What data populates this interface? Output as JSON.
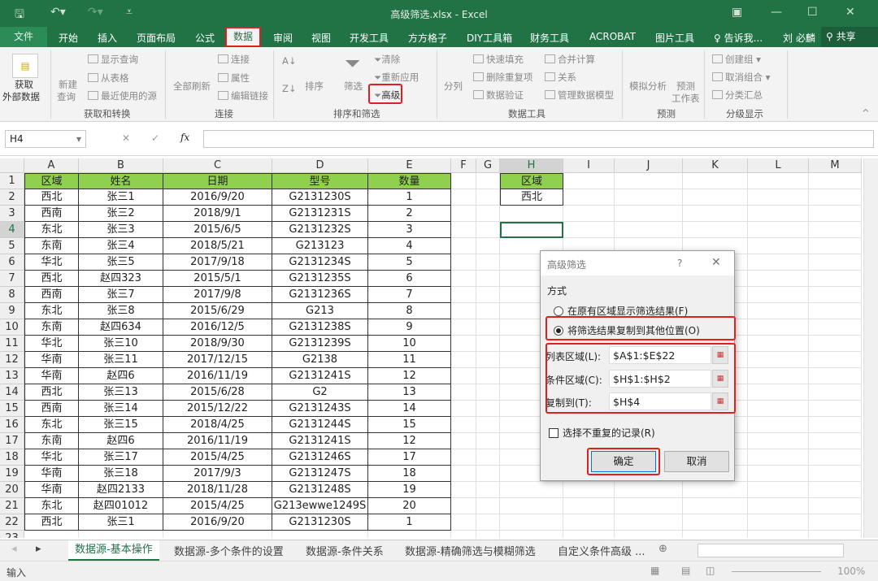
{
  "window": {
    "title": "高级筛选.xlsx - Excel",
    "user": "刘 必麟",
    "share": "共享",
    "tell_me": "告诉我..."
  },
  "tabs": [
    "文件",
    "开始",
    "插入",
    "页面布局",
    "公式",
    "数据",
    "审阅",
    "视图",
    "开发工具",
    "方方格子",
    "DIY工具箱",
    "财务工具",
    "ACROBAT",
    "图片工具"
  ],
  "active_tab": "数据",
  "ribbon": {
    "get_external": "获取\n外部数据",
    "get_external_1": "获取",
    "get_external_2": "外部数据",
    "new_query_1": "新建",
    "new_query_2": "查询",
    "show_queries": "显示查询",
    "from_table": "从表格",
    "recent_sources": "最近使用的源",
    "group_get": "获取和转换",
    "refresh_all": "全部刷新",
    "connections": "连接",
    "properties": "属性",
    "edit_links": "编辑链接",
    "group_conn": "连接",
    "sort": "排序",
    "filter": "筛选",
    "clear": "清除",
    "reapply": "重新应用",
    "advanced": "高级",
    "group_sort": "排序和筛选",
    "text_to_columns": "分列",
    "flash_fill": "快速填充",
    "remove_dup": "删除重复项",
    "data_validation": "数据验证",
    "consolidate": "合并计算",
    "relationships": "关系",
    "manage_model": "管理数据模型",
    "group_tools": "数据工具",
    "what_if": "模拟分析",
    "forecast_1": "预测",
    "forecast_2": "工作表",
    "group_forecast": "预测",
    "group_create": "创建组",
    "ungroup": "取消组合",
    "subtotal": "分类汇总",
    "group_outline": "分级显示"
  },
  "formula_bar": {
    "name_box": "H4",
    "fx": "fx",
    "value": ""
  },
  "columns": [
    "A",
    "B",
    "C",
    "D",
    "E",
    "F",
    "G",
    "H",
    "I",
    "J",
    "K",
    "L",
    "M"
  ],
  "table": {
    "headers": [
      "区域",
      "姓名",
      "日期",
      "型号",
      "数量"
    ],
    "rows": [
      [
        "西北",
        "张三1",
        "2016/9/20",
        "G2131230S",
        "1"
      ],
      [
        "西南",
        "张三2",
        "2018/9/1",
        "G2131231S",
        "2"
      ],
      [
        "东北",
        "张三3",
        "2015/6/5",
        "G2131232S",
        "3"
      ],
      [
        "东南",
        "张三4",
        "2018/5/21",
        "G213123",
        "4"
      ],
      [
        "华北",
        "张三5",
        "2017/9/18",
        "G2131234S",
        "5"
      ],
      [
        "西北",
        "赵四323",
        "2015/5/1",
        "G2131235S",
        "6"
      ],
      [
        "西南",
        "张三7",
        "2017/9/8",
        "G2131236S",
        "7"
      ],
      [
        "东北",
        "张三8",
        "2015/6/29",
        "G213",
        "8"
      ],
      [
        "东南",
        "赵四634",
        "2016/12/5",
        "G2131238S",
        "9"
      ],
      [
        "华北",
        "张三10",
        "2018/9/30",
        "G2131239S",
        "10"
      ],
      [
        "华南",
        "张三11",
        "2017/12/15",
        "G2138",
        "11"
      ],
      [
        "华南",
        "赵四6",
        "2016/11/19",
        "G2131241S",
        "12"
      ],
      [
        "西北",
        "张三13",
        "2015/6/28",
        "G2",
        "13"
      ],
      [
        "西南",
        "张三14",
        "2015/12/22",
        "G2131243S",
        "14"
      ],
      [
        "东北",
        "张三15",
        "2018/4/25",
        "G2131244S",
        "15"
      ],
      [
        "东南",
        "赵四6",
        "2016/11/19",
        "G2131241S",
        "12"
      ],
      [
        "华北",
        "张三17",
        "2015/4/25",
        "G2131246S",
        "17"
      ],
      [
        "华南",
        "张三18",
        "2017/9/3",
        "G2131247S",
        "18"
      ],
      [
        "华南",
        "赵四2133",
        "2018/11/28",
        "G2131248S",
        "19"
      ],
      [
        "东北",
        "赵四01012",
        "2015/4/25",
        "G213ewwe1249S",
        "20"
      ],
      [
        "西北",
        "张三1",
        "2016/9/20",
        "G2131230S",
        "1"
      ]
    ]
  },
  "criteria": {
    "header": "区域",
    "value": "西北"
  },
  "dialog": {
    "title": "高级筛选",
    "help": "?",
    "section": "方式",
    "opt1": "在原有区域显示筛选结果(F)",
    "opt2": "将筛选结果复制到其他位置(O)",
    "list_label": "列表区域(L):",
    "list_value": "$A$1:$E$22",
    "criteria_label": "条件区域(C):",
    "criteria_value": "$H$1:$H$2",
    "copy_label": "复制到(T):",
    "copy_value": "$H$4",
    "unique": "选择不重复的记录(R)",
    "ok": "确定",
    "cancel": "取消"
  },
  "sheets": [
    "数据源-基本操作",
    "数据源-多个条件的设置",
    "数据源-条件关系",
    "数据源-精确筛选与模糊筛选",
    "自定义条件高级 ..."
  ],
  "status": {
    "mode": "输入",
    "zoom": "100%"
  },
  "colors": {
    "excel_green": "#217346",
    "header_fill": "#8fd14f",
    "highlight": "#e02020"
  }
}
